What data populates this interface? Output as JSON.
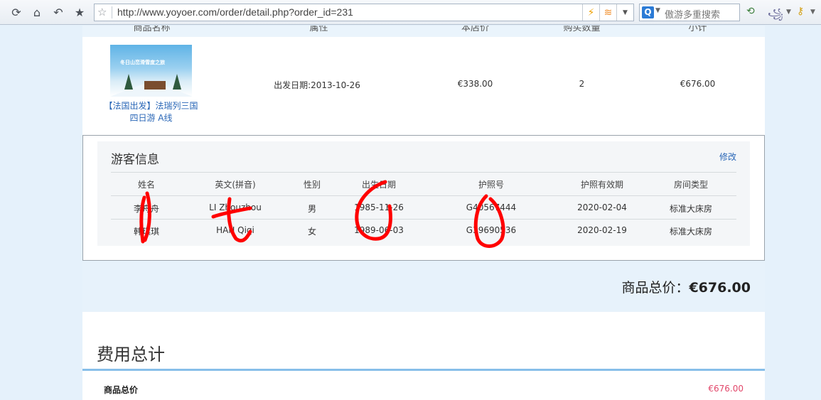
{
  "browser": {
    "url": "http://www.yoyoer.com/order/detail.php?order_id=231",
    "search_placeholder": "傲游多重搜索",
    "search_logo": "Q"
  },
  "product_table": {
    "headers": [
      "商品名称",
      "属性",
      "本店价",
      "购买数量",
      "小计"
    ],
    "row": {
      "image_caption": "冬日山峦滑雪度之旅",
      "name": "【法国出发】法瑞列三国四日游 A线",
      "attribute": "出发日期:2013-10-26",
      "price": "€338.00",
      "quantity": "2",
      "subtotal": "€676.00"
    }
  },
  "tourists": {
    "title": "游客信息",
    "edit_label": "修改",
    "headers": [
      "姓名",
      "英文(拼音)",
      "性别",
      "出生日期",
      "护照号",
      "护照有效期",
      "房间类型"
    ],
    "rows": [
      [
        "李舟舟",
        "LI Zhouzhou",
        "男",
        "1985-11-26",
        "G40567444",
        "2020-02-04",
        "标准大床房"
      ],
      [
        "韩琪琪",
        "HAN Qiqi",
        "女",
        "1989-06-03",
        "G39690536",
        "2020-02-19",
        "标准大床房"
      ]
    ]
  },
  "goods_total": {
    "label": "商品总价：",
    "value": "€676.00"
  },
  "fees": {
    "title": "费用总计",
    "label": "商品总价",
    "value": "€676.00"
  },
  "colors": {
    "link": "#2a67b7",
    "accent_red": "#e2486b",
    "annotation_red": "#ff0000",
    "band": "#e7f2fb"
  }
}
